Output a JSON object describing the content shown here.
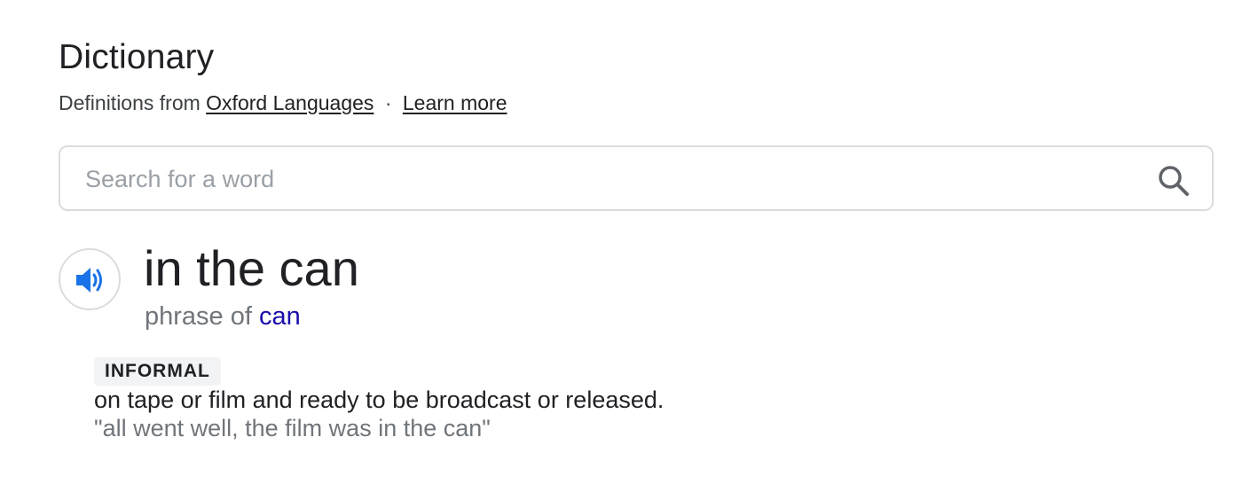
{
  "header": {
    "title": "Dictionary",
    "source_prefix": "Definitions from",
    "source_link": "Oxford Languages",
    "separator": "·",
    "learn_more": "Learn more"
  },
  "search": {
    "placeholder": "Search for a word",
    "value": "",
    "icon": "search-icon"
  },
  "entry": {
    "audio_icon": "speaker-icon",
    "headword": "in the can",
    "phrase_prefix": "phrase of",
    "phrase_link": "can",
    "sense": {
      "label": "INFORMAL",
      "definition": "on tape or film and ready to be broadcast or released.",
      "example": "\"all went well, the film was in the can\""
    }
  },
  "colors": {
    "link_blue": "#1a0dab",
    "audio_blue": "#1a73e8",
    "muted_gray": "#70757a",
    "border_gray": "#dadce0"
  }
}
